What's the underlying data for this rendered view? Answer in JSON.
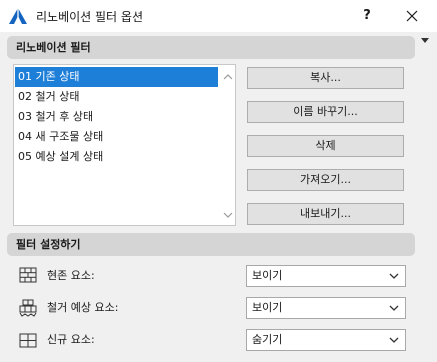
{
  "window": {
    "title": "리노베이션 필터 옵션",
    "help_label": "?",
    "close_icon": "close-icon"
  },
  "filters_section": {
    "header": "리노베이션 필터",
    "items": [
      {
        "label": "01 기존 상태",
        "selected": true
      },
      {
        "label": "02 철거 상태",
        "selected": false
      },
      {
        "label": "03 철거 후 상태",
        "selected": false
      },
      {
        "label": "04 새 구조물 상태",
        "selected": false
      },
      {
        "label": "05 예상 설계 상태",
        "selected": false
      }
    ],
    "buttons": {
      "copy": "복사...",
      "rename": "이름 바꾸기...",
      "delete": "삭제",
      "import": "가져오기...",
      "export": "내보내기..."
    }
  },
  "settings_section": {
    "header": "필터 설정하기",
    "rows": [
      {
        "label": "현존 요소:",
        "value": "보이기",
        "icon": "existing-elements-brick-icon"
      },
      {
        "label": "철거 예상 요소:",
        "value": "보이기",
        "icon": "demolished-elements-icon"
      },
      {
        "label": "신규 요소:",
        "value": "숨기기",
        "icon": "new-elements-icon"
      }
    ]
  },
  "colors": {
    "selection": "#1e7fd9",
    "section_header": "#d5d5d5",
    "window_bg": "#f0f0f0",
    "app_icon_blue": "#1565c0"
  }
}
